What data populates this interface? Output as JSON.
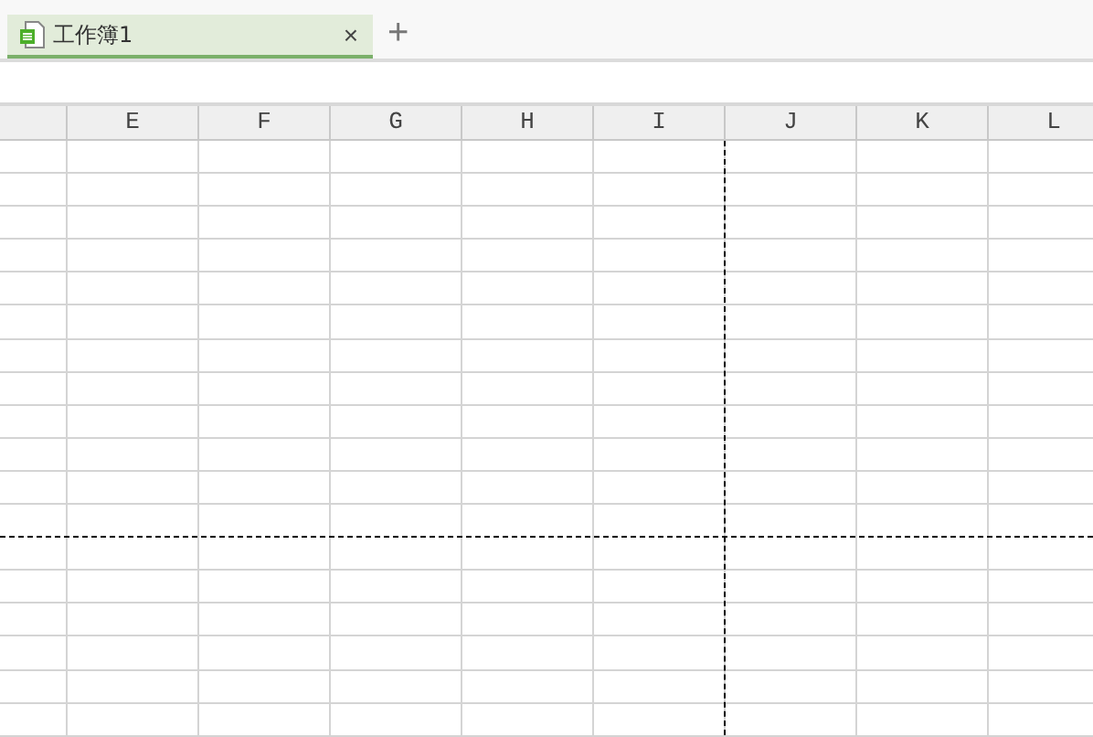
{
  "tabs": [
    {
      "label": "工作簿1",
      "selected": true,
      "close": "×"
    }
  ],
  "new_tab": "+",
  "columns": [
    {
      "page_break": false
    },
    {
      "label": "E",
      "page_break": false
    },
    {
      "label": "F",
      "page_break": false
    },
    {
      "label": "G",
      "page_break": false
    },
    {
      "label": "H",
      "page_break": false
    },
    {
      "label": "I",
      "page_break": true
    },
    {
      "label": "J",
      "page_break": false
    },
    {
      "label": "K",
      "page_break": false
    },
    {
      "label": "L",
      "page_break": false
    }
  ],
  "rows": [
    {
      "page_break": false
    },
    {
      "page_break": false
    },
    {
      "page_break": false
    },
    {
      "page_break": false
    },
    {
      "page_break": false
    },
    {
      "page_break": false
    },
    {
      "page_break": false
    },
    {
      "page_break": false
    },
    {
      "page_break": false
    },
    {
      "page_break": false
    },
    {
      "page_break": false
    },
    {
      "page_break": true
    },
    {
      "page_break": false
    },
    {
      "page_break": false
    },
    {
      "page_break": false
    },
    {
      "page_break": false
    },
    {
      "page_break": false
    },
    {
      "page_break": false
    }
  ]
}
